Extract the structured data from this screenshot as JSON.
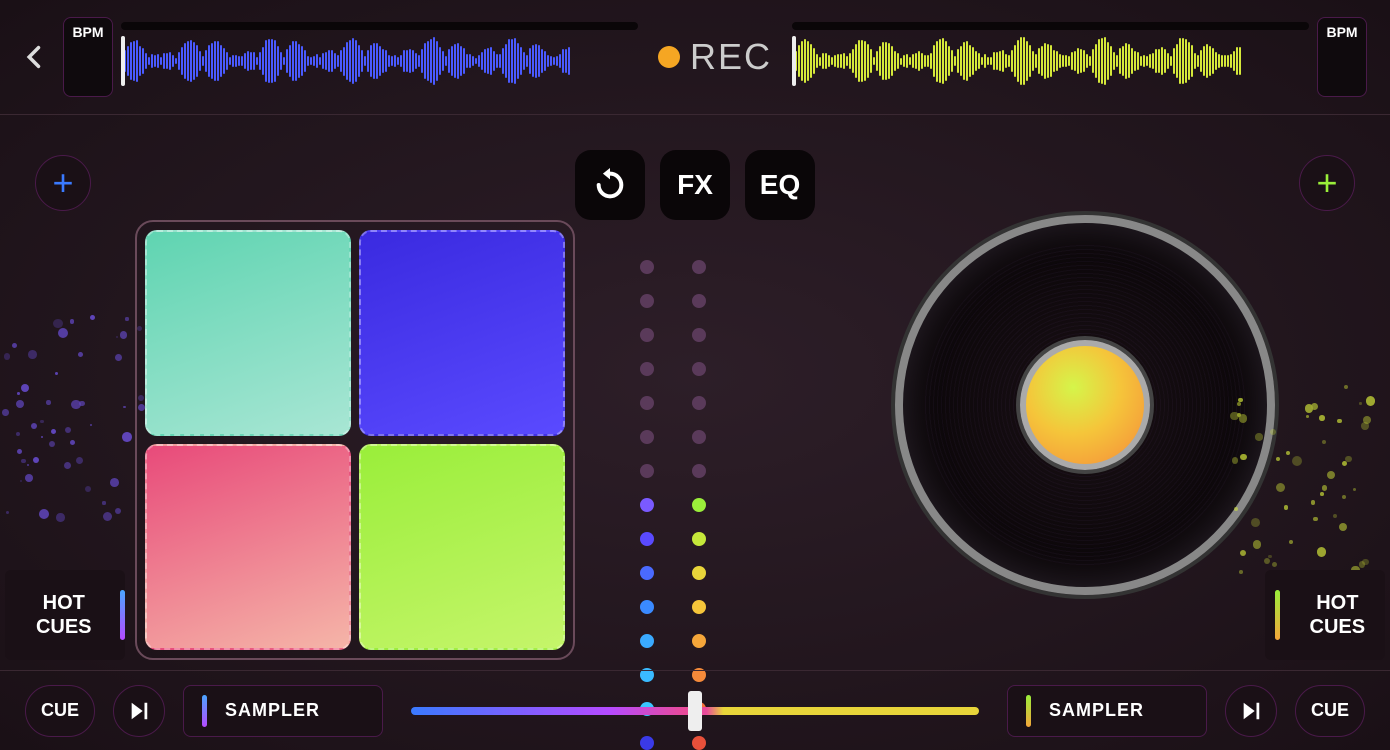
{
  "topbar": {
    "bpm_left": "BPM",
    "bpm_right": "BPM",
    "rec_label": "REC",
    "wave_left_color": "#4a5aff",
    "wave_right_color": "#d5e83a"
  },
  "center_buttons": {
    "loop_icon": "loop",
    "fx_label": "FX",
    "eq_label": "EQ"
  },
  "pads": [
    {
      "name": "pad-1",
      "class": "pad-teal"
    },
    {
      "name": "pad-2",
      "class": "pad-blue"
    },
    {
      "name": "pad-3",
      "class": "pad-pink"
    },
    {
      "name": "pad-4",
      "class": "pad-lime"
    }
  ],
  "levels": {
    "left": [
      "#5a3a5a",
      "#5a3a5a",
      "#5a3a5a",
      "#5a3a5a",
      "#5a3a5a",
      "#5a3a5a",
      "#5a3a5a",
      "#7a5aff",
      "#5a4aff",
      "#4a6aff",
      "#3a8aff",
      "#3aaaff",
      "#3abaff",
      "#3ac5ff",
      "#3a3ae8"
    ],
    "right": [
      "#5a3a5a",
      "#5a3a5a",
      "#5a3a5a",
      "#5a3a5a",
      "#5a3a5a",
      "#5a3a5a",
      "#5a3a5a",
      "#9aee3a",
      "#c5e83a",
      "#e8d53a",
      "#f5c53a",
      "#f5a63a",
      "#f58a3a",
      "#f5703a",
      "#e8503a"
    ]
  },
  "hotcues": {
    "label": "HOT CUES"
  },
  "bottom": {
    "cue_label": "CUE",
    "sampler_label": "SAMPLER"
  },
  "colors": {
    "accent_blue": "#3a7aff",
    "accent_green": "#9aee3a",
    "accent_orange": "#f5a623"
  }
}
